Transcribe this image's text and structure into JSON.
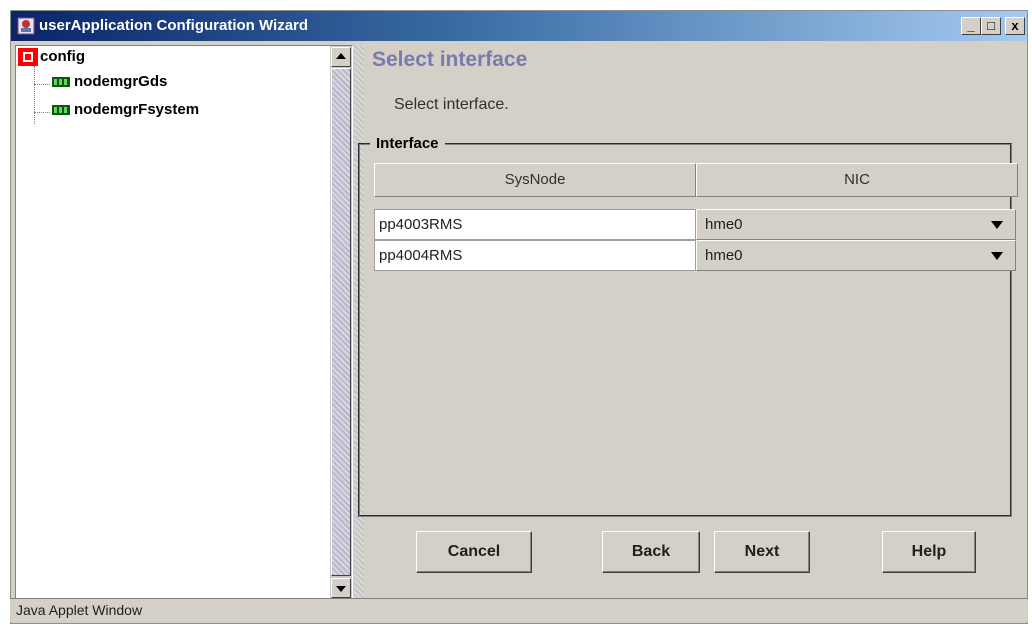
{
  "window": {
    "title": "userApplication Configuration Wizard",
    "controls": {
      "minimize": "_",
      "maximize": "□",
      "close": "x"
    }
  },
  "tree": {
    "root": {
      "label": "config",
      "icon": "config-icon"
    },
    "children": [
      {
        "label": "nodemgrGds",
        "icon": "resource-icon"
      },
      {
        "label": "nodemgrFsystem",
        "icon": "resource-icon"
      }
    ]
  },
  "main": {
    "heading": "Select interface",
    "description": "Select interface.",
    "group_label": "Interface",
    "table": {
      "columns": [
        "SysNode",
        "NIC"
      ],
      "rows": [
        {
          "sysnode": "pp4003RMS",
          "nic": "hme0"
        },
        {
          "sysnode": "pp4004RMS",
          "nic": "hme0"
        }
      ]
    }
  },
  "buttons": {
    "cancel": "Cancel",
    "back": "Back",
    "next": "Next",
    "help": "Help"
  },
  "status": "Java Applet Window",
  "colors": {
    "title_start": "#0a246a",
    "title_end": "#a6caf0",
    "heading": "#7a7ab0",
    "face": "#d4d0c8"
  }
}
